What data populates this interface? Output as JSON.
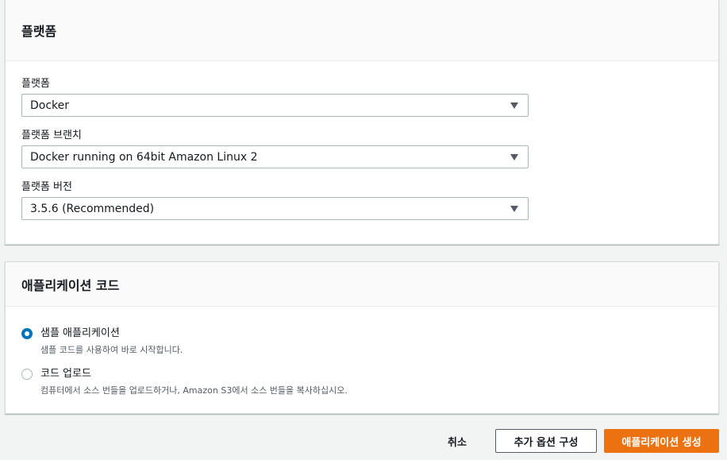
{
  "platform_panel": {
    "title": "플랫폼",
    "platform": {
      "label": "플랫폼",
      "value": "Docker"
    },
    "branch": {
      "label": "플랫폼 브랜치",
      "value": "Docker running on 64bit Amazon Linux 2"
    },
    "version": {
      "label": "플랫폼 버전",
      "value": "3.5.6 (Recommended)"
    }
  },
  "code_panel": {
    "title": "애플리케이션 코드",
    "options": [
      {
        "label": "샘플 애플리케이션",
        "description": "샘플 코드를 사용하여 바로 시작합니다.",
        "selected": true
      },
      {
        "label": "코드 업로드",
        "description": "컴퓨터에서 소스 번들을 업로드하거나, Amazon S3에서 소스 번들을 복사하십시오.",
        "selected": false
      }
    ]
  },
  "footer": {
    "cancel": "취소",
    "more_options": "추가 옵션 구성",
    "create": "애플리케이션 생성"
  },
  "colors": {
    "accent": "#0073bb",
    "primary_button": "#ec7211"
  }
}
